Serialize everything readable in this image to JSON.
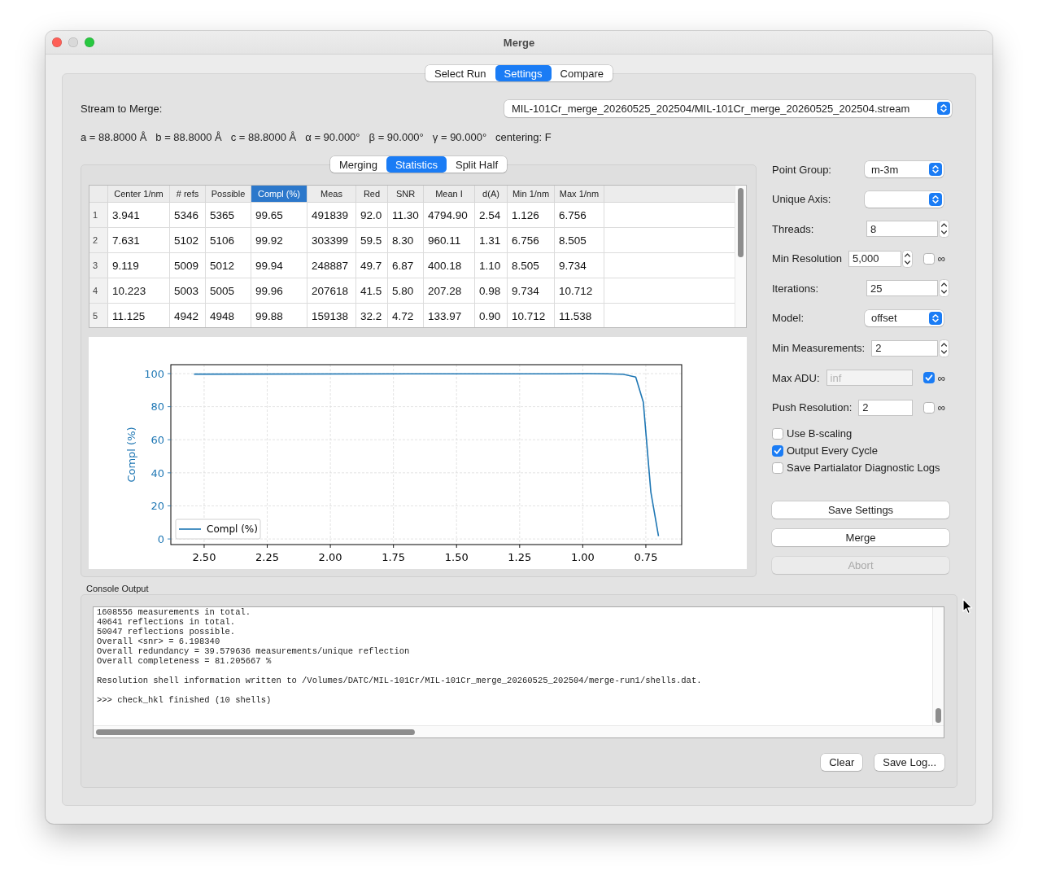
{
  "window": {
    "title": "Merge"
  },
  "tabs": [
    {
      "label": "Select Run",
      "selected": false
    },
    {
      "label": "Settings",
      "selected": true
    },
    {
      "label": "Compare",
      "selected": false
    }
  ],
  "stream": {
    "label": "Stream to Merge:",
    "value": "MIL-101Cr_merge_20260525_202504/MIL-101Cr_merge_20260525_202504.stream"
  },
  "cell_parameters": [
    "a = 88.8000 Å",
    "b = 88.8000 Å",
    "c = 88.8000 Å",
    "α = 90.000°",
    "β = 90.000°",
    "γ = 90.000°",
    "centering: F"
  ],
  "results": {
    "tabs": [
      {
        "label": "Merging",
        "selected": false
      },
      {
        "label": "Statistics",
        "selected": true
      },
      {
        "label": "Split Half",
        "selected": false
      }
    ],
    "table": {
      "columns": [
        {
          "label": "Center 1/nm",
          "selected": false
        },
        {
          "label": "# refs",
          "selected": false
        },
        {
          "label": "Possible",
          "selected": false
        },
        {
          "label": "Compl (%)",
          "selected": true
        },
        {
          "label": "Meas",
          "selected": false
        },
        {
          "label": "Red",
          "selected": false
        },
        {
          "label": "SNR",
          "selected": false
        },
        {
          "label": "Mean I",
          "selected": false
        },
        {
          "label": "d(A)",
          "selected": false
        },
        {
          "label": "Min 1/nm",
          "selected": false
        },
        {
          "label": "Max 1/nm",
          "selected": false
        }
      ],
      "rows": [
        {
          "number": "1",
          "cells": [
            "3.941",
            "5346",
            "5365",
            "99.65",
            "491839",
            "92.0",
            "11.30",
            "4794.90",
            "2.54",
            "1.126",
            "6.756"
          ]
        },
        {
          "number": "2",
          "cells": [
            "7.631",
            "5102",
            "5106",
            "99.92",
            "303399",
            "59.5",
            "8.30",
            "960.11",
            "1.31",
            "6.756",
            "8.505"
          ]
        },
        {
          "number": "3",
          "cells": [
            "9.119",
            "5009",
            "5012",
            "99.94",
            "248887",
            "49.7",
            "6.87",
            "400.18",
            "1.10",
            "8.505",
            "9.734"
          ]
        },
        {
          "number": "4",
          "cells": [
            "10.223",
            "5003",
            "5005",
            "99.96",
            "207618",
            "41.5",
            "5.80",
            "207.28",
            "0.98",
            "9.734",
            "10.712"
          ]
        },
        {
          "number": "5",
          "cells": [
            "11.125",
            "4942",
            "4948",
            "99.88",
            "159138",
            "32.2",
            "4.72",
            "133.97",
            "0.90",
            "10.712",
            "11.538"
          ]
        }
      ]
    },
    "chart_data": {
      "type": "line",
      "ylabel": "Compl (%)",
      "x": [
        2.54,
        1.31,
        1.1,
        0.98,
        0.9,
        0.84,
        0.79,
        0.76,
        0.73,
        0.7
      ],
      "series": [
        {
          "name": "Compl (%)",
          "color": "#1f77b4",
          "values": [
            99.7,
            99.9,
            99.9,
            100,
            99.9,
            99.6,
            97.9,
            82.8,
            28.3,
            1.7
          ]
        }
      ],
      "xlim": [
        2.632,
        0.608
      ],
      "ylim": [
        -3.4,
        105.4
      ],
      "xticks": [
        {
          "value": 2.5,
          "label": "2.50"
        },
        {
          "value": 2.25,
          "label": "2.25"
        },
        {
          "value": 2.0,
          "label": "2.00"
        },
        {
          "value": 1.75,
          "label": "1.75"
        },
        {
          "value": 1.5,
          "label": "1.50"
        },
        {
          "value": 1.25,
          "label": "1.25"
        },
        {
          "value": 1.0,
          "label": "1.00"
        },
        {
          "value": 0.75,
          "label": "0.75"
        }
      ],
      "yticks": [
        0,
        20,
        40,
        60,
        80,
        100
      ],
      "grid": true
    }
  },
  "settings": {
    "fields": [
      {
        "kind": "combo",
        "label": "Point Group:",
        "value": "m-3m",
        "disabled": false
      },
      {
        "kind": "combo",
        "label": "Unique Axis:",
        "disabled": false
      },
      {
        "kind": "spin",
        "label": "Threads:",
        "value": "8",
        "disabled": false
      },
      {
        "kind": "spin_infinity",
        "label": "Min Resolution",
        "value": "5,000",
        "disabled": false,
        "infinity": {
          "label": "∞",
          "checked": false
        }
      },
      {
        "kind": "spin",
        "label": "Iterations:",
        "value": "25",
        "disabled": false
      },
      {
        "kind": "combo",
        "label": "Model:",
        "value": "offset",
        "disabled": false
      },
      {
        "kind": "spin",
        "label": "Min Measurements:",
        "value": "2",
        "disabled": false
      },
      {
        "kind": "text_infinity",
        "label": "Max ADU:",
        "value": "inf",
        "disabled": true,
        "infinity": {
          "label": "∞",
          "checked": true
        }
      },
      {
        "kind": "text_infinity",
        "label": "Push Resolution:",
        "value": "2",
        "disabled": false,
        "infinity": {
          "label": "∞",
          "checked": false
        }
      }
    ],
    "checkboxes": [
      {
        "label": "Use B-scaling",
        "checked": false
      },
      {
        "label": "Output Every Cycle",
        "checked": true
      },
      {
        "label": "Save Partialator Diagnostic Logs",
        "checked": false
      }
    ],
    "buttons": [
      {
        "label": "Save Settings",
        "disabled": false
      },
      {
        "label": "Merge",
        "disabled": false
      },
      {
        "label": "Abort",
        "disabled": true
      }
    ]
  },
  "console": {
    "title": "Console Output",
    "blocks": [
      [
        "1608556 measurements in total.",
        "40641 reflections in total.",
        "50047 reflections possible.",
        "Overall <snr> = 6.198340",
        "Overall redundancy = 39.579636 measurements/unique reflection",
        "Overall completeness = 81.205667 %"
      ],
      [
        "Resolution shell information written to /Volumes/DATC/MIL-101Cr/MIL-101Cr_merge_20260525_202504/merge-run1/shells.dat."
      ],
      [
        ">>> check_hkl finished (10 shells)"
      ]
    ],
    "buttons": [
      "Clear",
      "Save Log..."
    ]
  }
}
